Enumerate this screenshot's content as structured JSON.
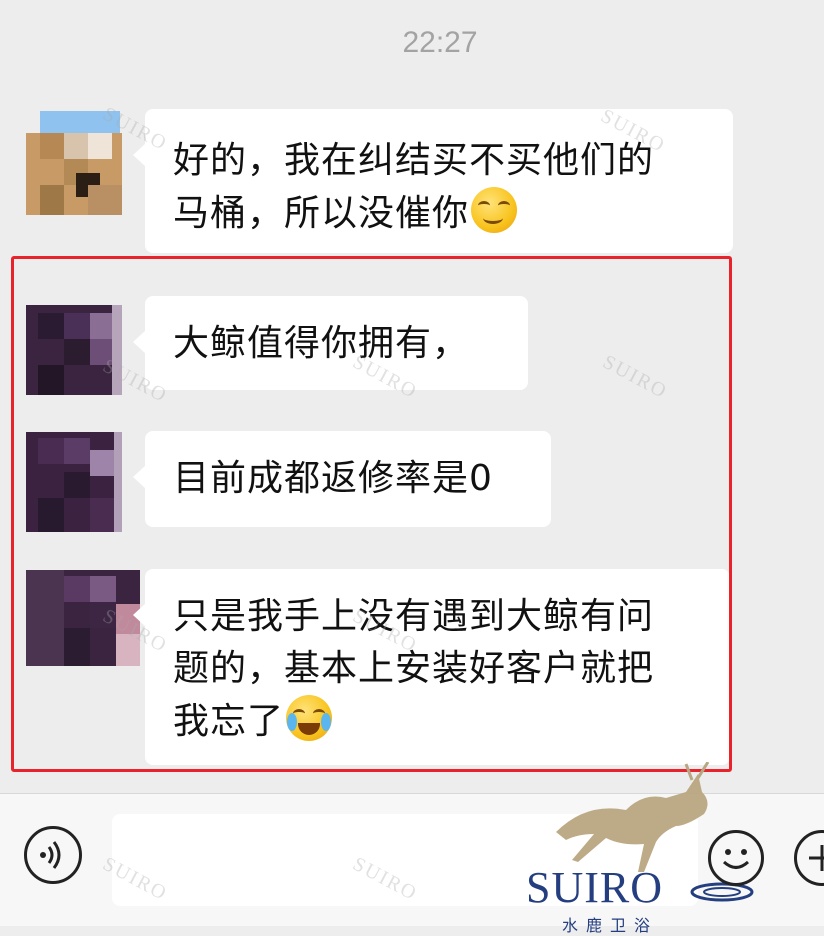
{
  "chat": {
    "timestamp": "22:27",
    "messages": [
      {
        "text_line1": "好的，我在纠结买不买他们的",
        "text_line2": "马桶，所以没催你",
        "emoji": "smirk-emoji"
      },
      {
        "text": "大鲸值得你拥有，"
      },
      {
        "text": "目前成都返修率是0"
      },
      {
        "text_line1": "只是我手上没有遇到大鲸有问",
        "text_line2": "题的，基本上安装好客户就把",
        "text_line3": "我忘了",
        "emoji": "crying-laughing-emoji"
      }
    ]
  },
  "toolbar": {
    "voice_icon": "voice-icon",
    "emoji_icon": "smiley-icon",
    "plus_icon": "plus-icon"
  },
  "watermark": {
    "brand": "SUIRO",
    "brand_sub": "水鹿卫浴"
  },
  "colors": {
    "highlight_border": "#e8232b",
    "chat_background": "#ededed",
    "bubble": "#ffffff",
    "brand_blue": "#243e80"
  }
}
